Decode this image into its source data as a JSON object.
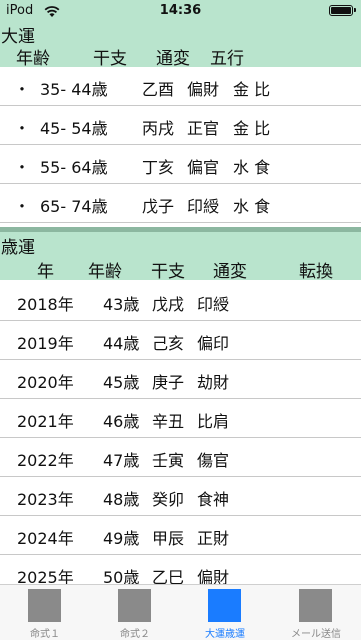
{
  "status": {
    "carrier": "iPod",
    "time": "14:36"
  },
  "taiun": {
    "title": "大運",
    "headers": {
      "age": "年齢",
      "kanshi": "干支",
      "tsuhen": "通変",
      "gogyo": "五行"
    },
    "rows": [
      {
        "bullet": "・",
        "age": "35- 44歳",
        "kanshi": "乙酉",
        "tsuhen": "偏財",
        "gogyo": "金 比"
      },
      {
        "bullet": "・",
        "age": "45- 54歳",
        "kanshi": "丙戌",
        "tsuhen": "正官",
        "gogyo": "金 比"
      },
      {
        "bullet": "・",
        "age": "55- 64歳",
        "kanshi": "丁亥",
        "tsuhen": "偏官",
        "gogyo": "水 食"
      },
      {
        "bullet": "・",
        "age": "65- 74歳",
        "kanshi": "戊子",
        "tsuhen": "印綬",
        "gogyo": "水 食"
      }
    ]
  },
  "saiun": {
    "title": "歳運",
    "headers": {
      "year": "年",
      "age": "年齢",
      "kanshi": "干支",
      "tsuhen": "通変",
      "tenkan": "転換"
    },
    "rows": [
      {
        "year": "2018年",
        "age": "43歳",
        "kanshi": "戊戌",
        "tsuhen": "印綬"
      },
      {
        "year": "2019年",
        "age": "44歳",
        "kanshi": "己亥",
        "tsuhen": "偏印"
      },
      {
        "year": "2020年",
        "age": "45歳",
        "kanshi": "庚子",
        "tsuhen": "劫財"
      },
      {
        "year": "2021年",
        "age": "46歳",
        "kanshi": "辛丑",
        "tsuhen": "比肩"
      },
      {
        "year": "2022年",
        "age": "47歳",
        "kanshi": "壬寅",
        "tsuhen": "傷官"
      },
      {
        "year": "2023年",
        "age": "48歳",
        "kanshi": "癸卯",
        "tsuhen": "食神"
      },
      {
        "year": "2024年",
        "age": "49歳",
        "kanshi": "甲辰",
        "tsuhen": "正財"
      },
      {
        "year": "2025年",
        "age": "50歳",
        "kanshi": "乙巳",
        "tsuhen": "偏財"
      }
    ]
  },
  "tabs": [
    {
      "label": "命式１",
      "active": false
    },
    {
      "label": "命式２",
      "active": false
    },
    {
      "label": "大運歳運",
      "active": true
    },
    {
      "label": "メール送信",
      "active": false
    }
  ]
}
